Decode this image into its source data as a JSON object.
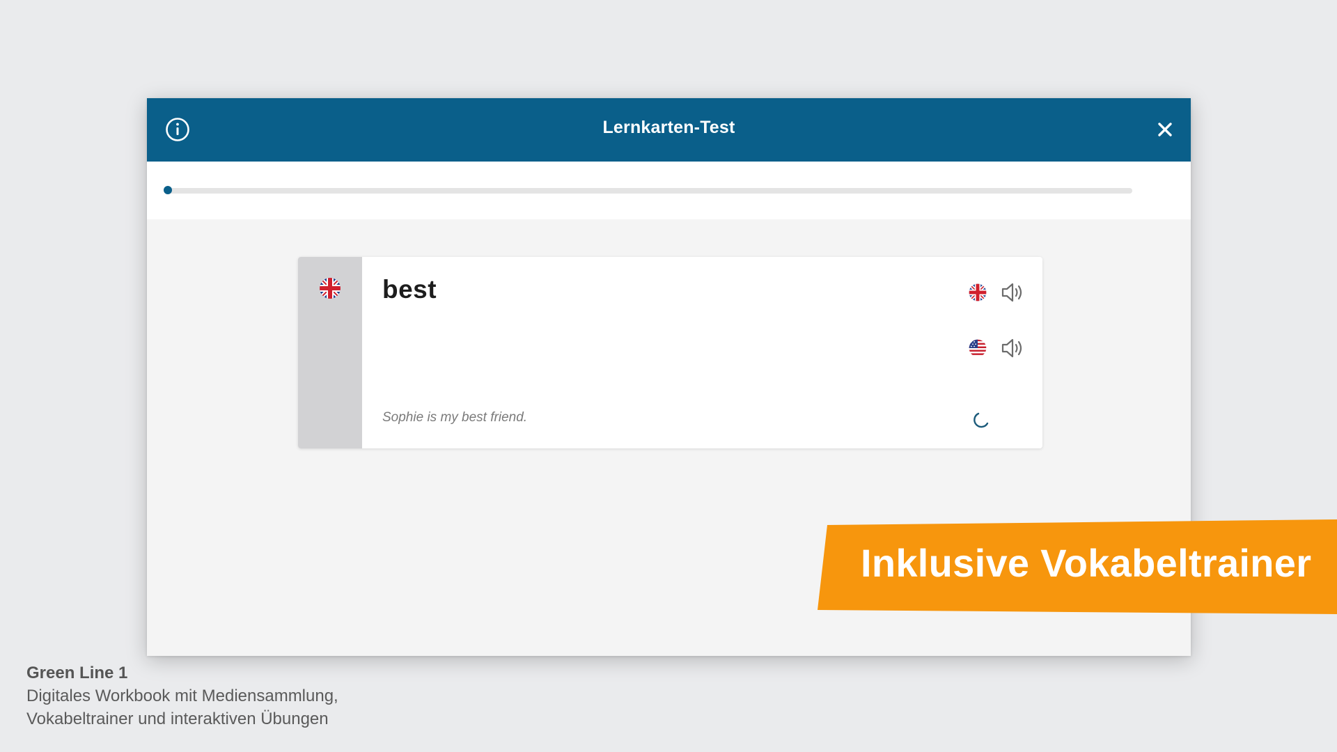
{
  "modal": {
    "title": "Lernkarten-Test",
    "progress_fraction": 0.0
  },
  "card": {
    "word": "best",
    "example": "Sophie is my best friend.",
    "pronunciations": [
      {
        "variant": "uk-flag-icon",
        "icon": "speaker-icon"
      },
      {
        "variant": "us-flag-icon",
        "icon": "speaker-icon"
      }
    ]
  },
  "banner": {
    "text": "Inklusive Vokabeltrainer"
  },
  "caption": {
    "title": "Green Line 1",
    "line1": "Digitales Workbook mit Mediensammlung,",
    "line2": "Vokabeltrainer und interaktiven Übungen"
  },
  "colors": {
    "header": "#0a5f8a",
    "accent_orange": "#f7960d",
    "background": "#eaebed"
  }
}
